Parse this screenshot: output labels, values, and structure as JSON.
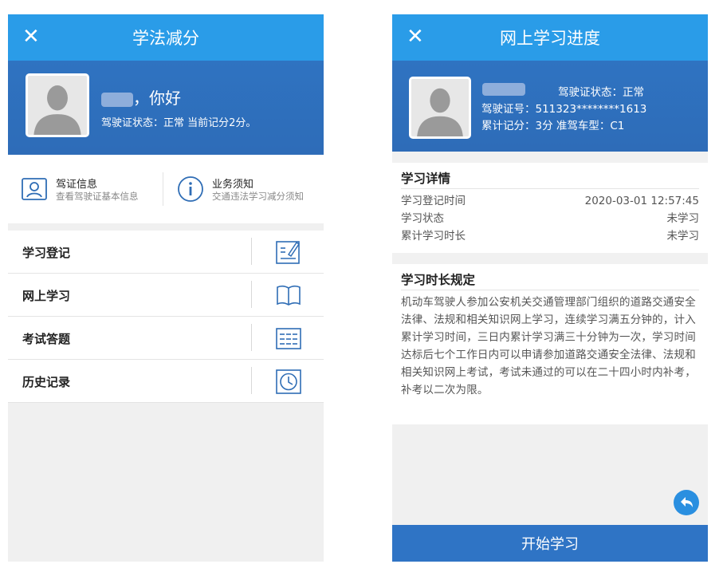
{
  "left": {
    "title": "学法减分",
    "close_icon": "close-icon",
    "greeting_suffix": "，你好",
    "license_status_line": "驾驶证状态：正常 当前记分2分。",
    "info": [
      {
        "icon": "id-card-icon",
        "title": "驾证信息",
        "subtitle": "查看驾驶证基本信息"
      },
      {
        "icon": "info-icon",
        "title": "业务须知",
        "subtitle": "交通违法学习减分须知"
      }
    ],
    "menu": [
      {
        "label": "学习登记",
        "icon": "register-edit-icon"
      },
      {
        "label": "网上学习",
        "icon": "book-icon"
      },
      {
        "label": "考试答题",
        "icon": "exam-list-icon"
      },
      {
        "label": "历史记录",
        "icon": "clock-icon"
      }
    ]
  },
  "right": {
    "title": "网上学习进度",
    "close_icon": "close-icon",
    "license_status": "驾驶证状态：正常",
    "license_number": "驾驶证号：511323********1613",
    "points_and_type": "累计记分：3分   准驾车型：C1",
    "details_title": "学习详情",
    "details": [
      {
        "key": "学习登记时间",
        "value": "2020-03-01 12:57:45"
      },
      {
        "key": "学习状态",
        "value": "未学习"
      },
      {
        "key": "累计学习时长",
        "value": "未学习"
      }
    ],
    "rules_title": "学习时长规定",
    "rules_text": "机动车驾驶人参加公安机关交通管理部门组织的道路交通安全法律、法规和相关知识网上学习，连续学习满五分钟的，计入累计学习时间，三日内累计学习满三十分钟为一次，学习时间达标后七个工作日内可以申请参加道路交通安全法律、法规和相关知识网上考试，考试未通过的可以在二十四小时内补考，补考以二次为限。",
    "start_button": "开始学习",
    "back_icon": "back-arrow-icon"
  },
  "colors": {
    "topbar": "#2a9ce8",
    "banner": "#2e6cb8",
    "button": "#2f74c5",
    "icon_stroke": "#2f6db5"
  }
}
